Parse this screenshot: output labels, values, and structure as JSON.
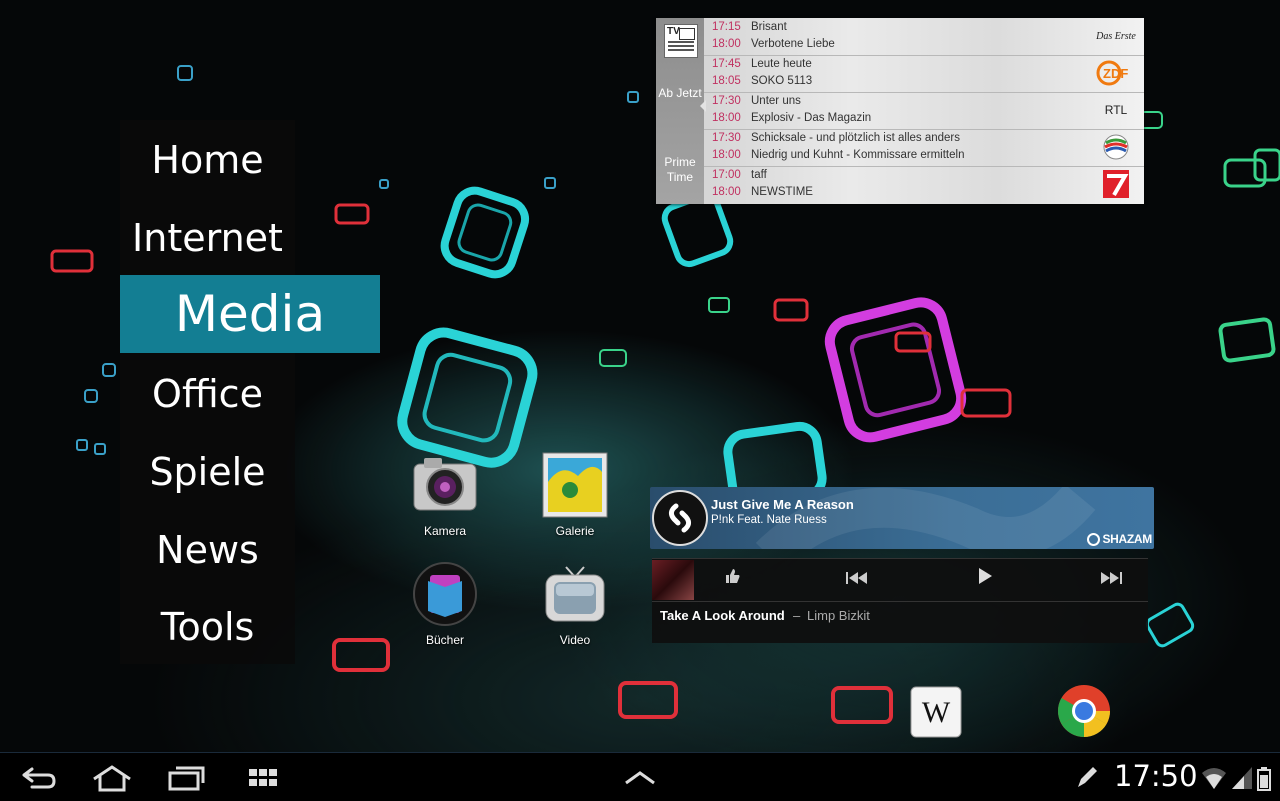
{
  "side_menu": {
    "items": [
      {
        "label": "Home",
        "active": false
      },
      {
        "label": "Internet",
        "active": false
      },
      {
        "label": "Media",
        "active": true
      },
      {
        "label": "Office",
        "active": false
      },
      {
        "label": "Spiele",
        "active": false
      },
      {
        "label": "News",
        "active": false
      },
      {
        "label": "Tools",
        "active": false
      }
    ],
    "active_color": "#137e93"
  },
  "tv_guide": {
    "logo_text": "TV",
    "tab_now": "Ab Jetzt",
    "tab_prime": "Prime Time",
    "rows": [
      {
        "time1": "17:15",
        "show1": "Brisant",
        "time2": "18:00",
        "show2": "Verbotene Liebe",
        "channel": "Das Erste"
      },
      {
        "time1": "17:45",
        "show1": "Leute heute",
        "time2": "18:05",
        "show2": "SOKO 5113",
        "channel": "ZDF"
      },
      {
        "time1": "17:30",
        "show1": "Unter uns",
        "time2": "18:00",
        "show2": "Explosiv - Das Magazin",
        "channel": "RTL"
      },
      {
        "time1": "17:30",
        "show1": "Schicksale - und plötzlich ist alles anders",
        "time2": "18:00",
        "show2": "Niedrig und Kuhnt - Kommissare ermitteln",
        "channel": "Sat.1"
      },
      {
        "time1": "17:00",
        "show1": "taff",
        "time2": "18:00",
        "show2": "NEWSTIME",
        "channel": "ProSieben"
      }
    ]
  },
  "apps": {
    "kamera": "Kamera",
    "galerie": "Galerie",
    "buecher": "Bücher",
    "video": "Video"
  },
  "shazam": {
    "title": "Just Give Me A Reason",
    "artist": "P!nk Feat. Nate Ruess",
    "brand": "SHAZAM"
  },
  "player": {
    "track": "Take A Look Around",
    "separator": "–",
    "artist": "Limp Bizkit"
  },
  "status_bar": {
    "time": "17:50"
  }
}
